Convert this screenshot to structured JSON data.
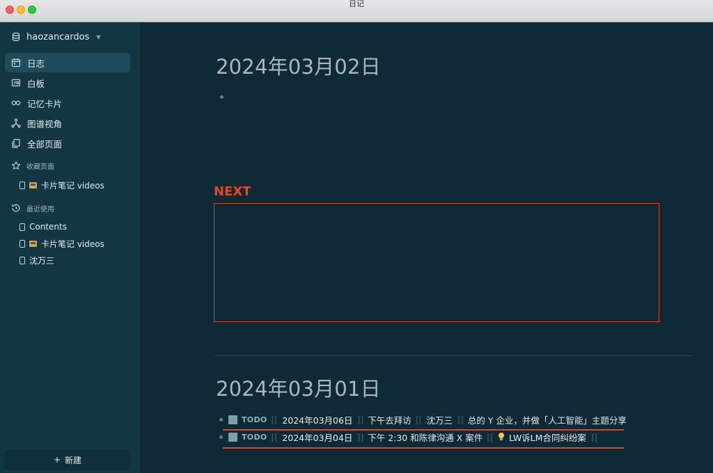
{
  "window": {
    "title": "日记"
  },
  "sidebar": {
    "workspace": "haozancardos",
    "nav": [
      {
        "label": "日志",
        "icon": "calendar-icon",
        "active": true
      },
      {
        "label": "白板",
        "icon": "whiteboard-icon"
      },
      {
        "label": "记忆卡片",
        "icon": "infinity-icon"
      },
      {
        "label": "图谱视角",
        "icon": "graph-icon"
      },
      {
        "label": "全部页面",
        "icon": "pages-icon"
      }
    ],
    "favorites": {
      "label": "收藏页面",
      "items": [
        {
          "label": "卡片笔记 videos",
          "emoji": "film-card-emoji"
        }
      ]
    },
    "recent": {
      "label": "最近使用",
      "items": [
        {
          "label": "Contents"
        },
        {
          "label": "卡片笔记 videos",
          "emoji": "film-card-emoji"
        },
        {
          "label": "沈万三"
        }
      ]
    },
    "new_button": {
      "plus": "+",
      "label": "新建"
    }
  },
  "main": {
    "journal1": {
      "title": "2024年03月02日"
    },
    "next": {
      "label": "NEXT"
    },
    "journal2": {
      "title": "2024年03月01日",
      "todos": [
        {
          "tag": "TODO",
          "date": "2024年03月06日",
          "text1": "下午去拜访",
          "person": "沈万三",
          "text2": "总的 Y 企业，并做「人工智能」主题分享"
        },
        {
          "tag": "TODO",
          "date": "2024年03月04日",
          "text1": "下午 2:30 和陈律沟通 X 案件",
          "ref": "LW诉LM合同纠纷案"
        }
      ]
    }
  },
  "colors": {
    "accent_red": "#d9442e",
    "background": "#0e2a35",
    "sidebar": "#123743"
  }
}
